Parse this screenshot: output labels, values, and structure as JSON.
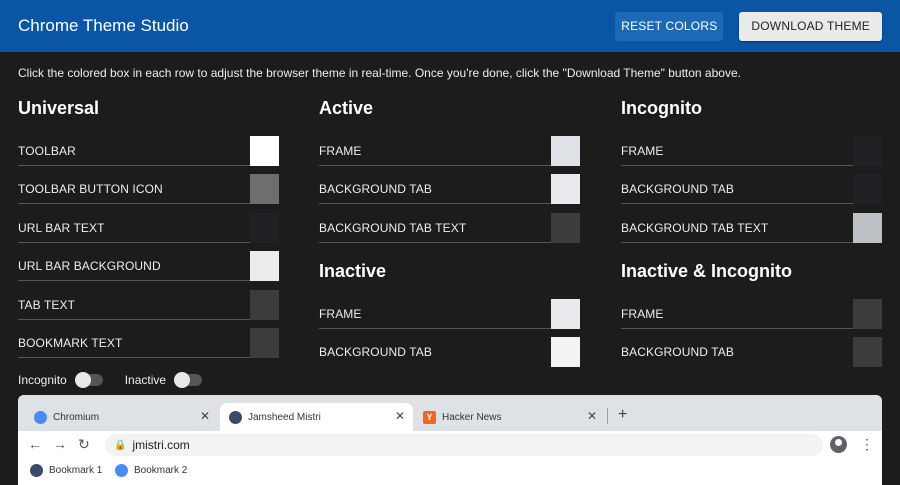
{
  "app": {
    "title": "Chrome Theme Studio",
    "reset_label": "RESET COLORS",
    "download_label": "DOWNLOAD THEME"
  },
  "intro_text": "Click the colored box in each row to adjust the browser theme in real-time. Once you're done, click the \"Download Theme\" button above.",
  "universal": {
    "title": "Universal",
    "rows": [
      {
        "label": "TOOLBAR",
        "color": "#ffffff"
      },
      {
        "label": "TOOLBAR BUTTON ICON",
        "color": "#6e6e6e"
      },
      {
        "label": "URL BAR TEXT",
        "color": "#202124"
      },
      {
        "label": "URL BAR BACKGROUND",
        "color": "#ececec"
      },
      {
        "label": "TAB TEXT",
        "color": "#3c3c3f"
      },
      {
        "label": "BOOKMARK TEXT",
        "color": "#3c3c3f"
      }
    ]
  },
  "active": {
    "title": "Active",
    "rows": [
      {
        "label": "FRAME",
        "color": "#dee1e6"
      },
      {
        "label": "BACKGROUND TAB",
        "color": "#e8eaed"
      },
      {
        "label": "BACKGROUND TAB TEXT",
        "color": "#3c3c3f"
      }
    ]
  },
  "inactive": {
    "title": "Inactive",
    "rows": [
      {
        "label": "FRAME",
        "color": "#e8eaed"
      },
      {
        "label": "BACKGROUND TAB",
        "color": "#f1f3f4"
      }
    ]
  },
  "incognito": {
    "title": "Incognito",
    "rows": [
      {
        "label": "FRAME",
        "color": "#202124"
      },
      {
        "label": "BACKGROUND TAB",
        "color": "#202124"
      },
      {
        "label": "BACKGROUND TAB TEXT",
        "color": "#bdc1c6"
      }
    ]
  },
  "inactive_incognito": {
    "title": "Inactive & Incognito",
    "rows": [
      {
        "label": "FRAME",
        "color": "#3c3c3f"
      },
      {
        "label": "BACKGROUND TAB",
        "color": "#3c3c3f"
      }
    ]
  },
  "toggles": {
    "incognito_label": "Incognito",
    "incognito_on": false,
    "inactive_label": "Inactive",
    "inactive_on": false
  },
  "preview": {
    "tabs": [
      {
        "title": "Chromium",
        "icon": "chromium-icon",
        "icon_color": "#4a8af4",
        "active": false
      },
      {
        "title": "Jamsheed Mistri",
        "icon": "avatar-icon",
        "icon_color": "#3b4a6b",
        "active": true
      },
      {
        "title": "Hacker News",
        "icon": "hacker-news-icon",
        "icon_letter": "Y",
        "icon_color": "#f26522",
        "active": false
      }
    ],
    "url": "jmistri.com",
    "bookmarks": [
      {
        "label": "Bookmark 1",
        "icon": "avatar-icon",
        "icon_color": "#3b4a6b"
      },
      {
        "label": "Bookmark 2",
        "icon": "chromium-icon",
        "icon_color": "#4a8af4"
      }
    ]
  },
  "colors": {
    "header_bg": "#0a56a4",
    "page_bg": "#1c1c1c"
  }
}
